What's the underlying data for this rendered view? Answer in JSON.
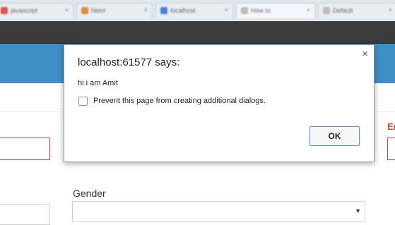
{
  "browser": {
    "tabs": [
      {
        "label": "javascript",
        "active": false,
        "favicon_color": "#d9534f"
      },
      {
        "label": "Nelvi",
        "active": false,
        "favicon_color": "#e08a3c"
      },
      {
        "label": "localhost",
        "active": false,
        "favicon_color": "#4a7fd0"
      },
      {
        "label": "How to",
        "active": true,
        "favicon_color": "#bbbbbb"
      },
      {
        "label": "Default",
        "active": false,
        "favicon_color": "#bbbbbb"
      }
    ]
  },
  "form": {
    "gender_label": "Gender",
    "right_label": "En"
  },
  "dialog": {
    "title": "localhost:61577 says:",
    "message": "hi i am Amit",
    "checkbox_label": "Prevent this page from creating additional dialogs.",
    "checkbox_checked": false,
    "ok_label": "OK",
    "close_glyph": "×"
  },
  "colors": {
    "header_blue": "#3e8fc6",
    "error_red": "#c9473d",
    "ok_border": "#4d90d6"
  }
}
